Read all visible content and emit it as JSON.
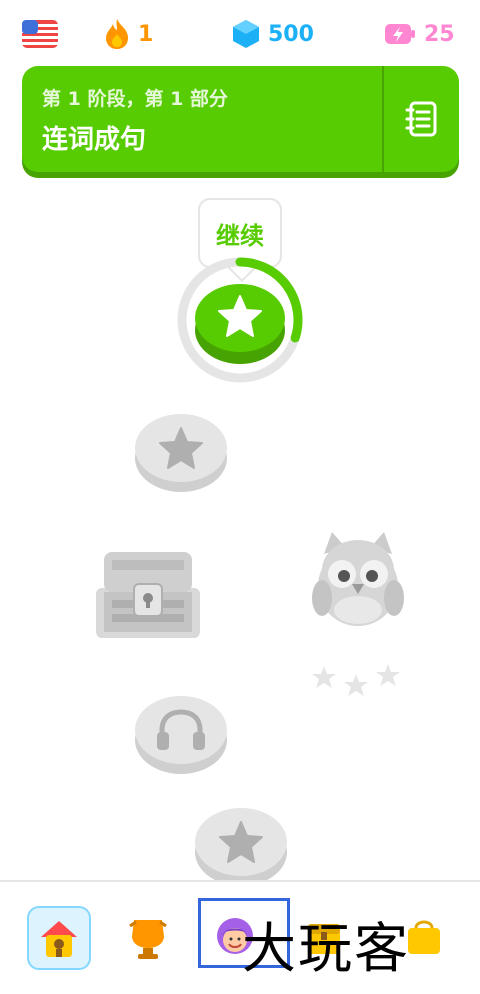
{
  "topbar": {
    "course_flag_icon": "us-flag-icon",
    "streak_count": "1",
    "gems_count": "500",
    "energy_count": "25"
  },
  "unit": {
    "subtitle": "第 1 阶段，第 1 部分",
    "title": "连词成句",
    "guidebook_icon": "guidebook-icon"
  },
  "path": {
    "tooltip_label": "继续",
    "current_progress": 0.3
  },
  "bottom_nav": {
    "items": [
      "home-icon",
      "leagues-icon",
      "profile-icon",
      "quests-icon",
      "shop-icon"
    ]
  },
  "colors": {
    "green": "#58cc02",
    "green_dark": "#46a302",
    "locked_gray": "#e5e5e5",
    "locked_dark": "#cfcfcf",
    "streak": "#ff9600",
    "gems": "#1cb0f6",
    "energy": "#ff86d0"
  },
  "overlay": {
    "watermark_text": "大玩客"
  }
}
